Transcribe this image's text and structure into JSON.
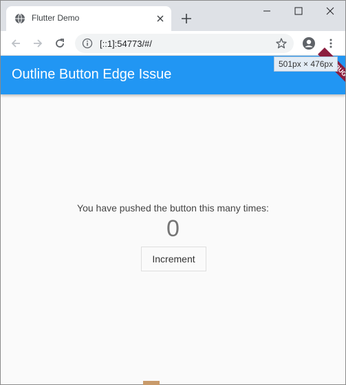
{
  "browser": {
    "tab_title": "Flutter Demo",
    "url": "[::1]:54773/#/",
    "size_tooltip": "501px × 476px"
  },
  "icons": {
    "favicon": "globe-icon",
    "close": "close-icon",
    "new_tab": "plus-icon",
    "back": "arrow-left-icon",
    "forward": "arrow-right-icon",
    "reload": "reload-icon",
    "info": "info-icon",
    "star": "star-icon",
    "profile": "account-circle-icon",
    "menu": "more-vert-icon"
  },
  "app": {
    "title": "Outline Button Edge Issue",
    "debug_banner": "DEBUG",
    "counter_label": "You have pushed the button this many times:",
    "counter_value": "0",
    "button_label": "Increment"
  },
  "colors": {
    "appbar": "#2196f3",
    "debug_banner": "#8b1e3f"
  }
}
